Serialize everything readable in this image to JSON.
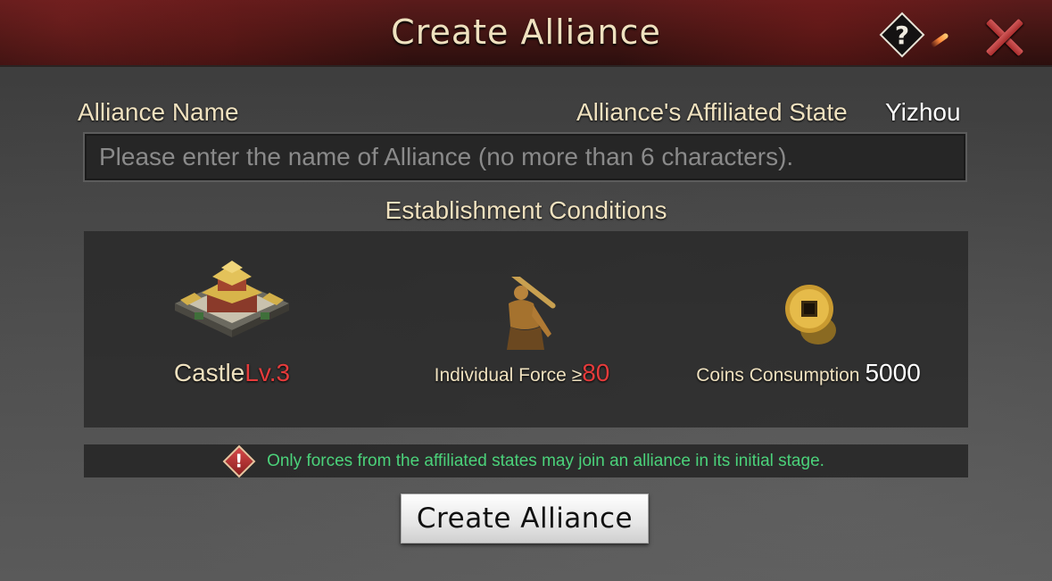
{
  "header": {
    "title": "Create Alliance",
    "help_icon": "question-mark-icon",
    "close_icon": "close-x-icon"
  },
  "form": {
    "name_label": "Alliance Name",
    "state_label": "Alliance's Affiliated State",
    "state_value": "Yizhou",
    "name_input": {
      "value": "",
      "placeholder": "Please enter the name of Alliance (no more than 6 characters)."
    }
  },
  "conditions": {
    "title": "Establishment Conditions",
    "castle": {
      "icon": "castle-icon",
      "label": "Castle",
      "requirement": "Lv.3"
    },
    "force": {
      "icon": "warrior-icon",
      "label": "Individual Force ≥",
      "requirement": "80"
    },
    "coins": {
      "icon": "coin-icon",
      "label": "Coins Consumption",
      "requirement": "5000"
    }
  },
  "notice": {
    "icon": "warning-icon",
    "text": "Only forces from the affiliated states may join an alliance in its initial stage."
  },
  "actions": {
    "create_label": "Create Alliance"
  },
  "colors": {
    "header_red": "#3e1412",
    "title_gold": "#efe1bf",
    "requirement_red": "#e53b3b",
    "notice_green": "#4bd27a"
  }
}
